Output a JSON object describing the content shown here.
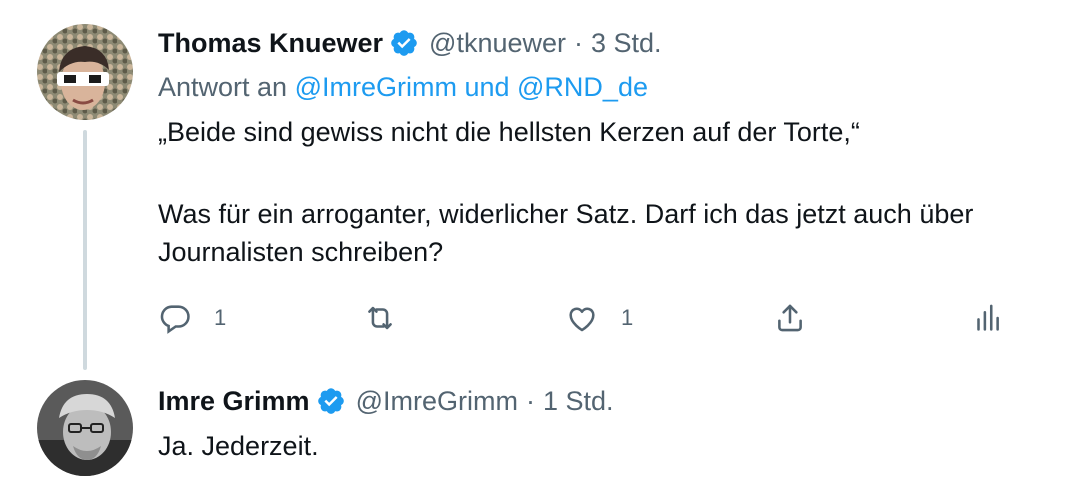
{
  "tweets": [
    {
      "author_name": "Thomas Knuewer",
      "handle": "@tknuewer",
      "separator": "·",
      "time": "3 Std.",
      "reply_prefix": "Antwort an",
      "reply_to": "@ImreGrimm und @RND_de",
      "text_lines": [
        "„Beide sind gewiss nicht die hellsten Kerzen auf der Torte,“",
        "Was für ein arroganter, widerlicher Satz. Darf ich das jetzt auch über",
        "Journalisten schreiben?"
      ],
      "actions": {
        "reply_count": "1",
        "retweet_count": "",
        "like_count": "1"
      },
      "icons": [
        "reply-icon",
        "retweet-icon",
        "like-icon",
        "share-icon",
        "analytics-icon"
      ]
    },
    {
      "author_name": "Imre Grimm",
      "handle": "@ImreGrimm",
      "separator": "·",
      "time": "1 Std.",
      "text_lines": [
        "Ja. Jederzeit."
      ]
    }
  ],
  "colors": {
    "text": "#0f1419",
    "secondary": "#536471",
    "link": "#1d9bf0",
    "verified": "#1d9bf0",
    "thread_line": "#cfd9de"
  }
}
